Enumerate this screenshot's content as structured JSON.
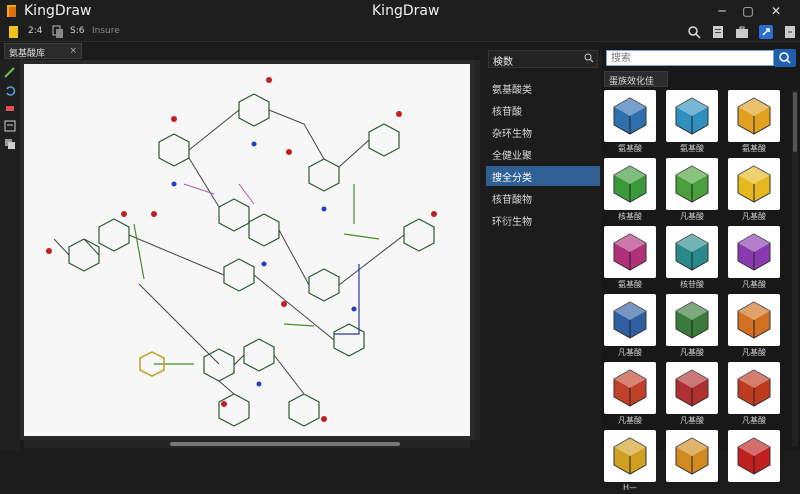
{
  "app": {
    "name": "KingDraw",
    "window_title": "KingDraw"
  },
  "toolbar": {
    "page_count": "2:4",
    "zoom": "S:6",
    "insert_label": "Insure"
  },
  "document": {
    "tab_label": "氨基酸库",
    "close": "×"
  },
  "middle_panel": {
    "header": "検数",
    "categories": [
      {
        "label": "氨基酸类",
        "selected": false
      },
      {
        "label": "核苷酸",
        "selected": false
      },
      {
        "label": "杂环生物",
        "selected": false
      },
      {
        "label": "全健业聚",
        "selected": false
      },
      {
        "label": "搜全分类",
        "selected": true
      },
      {
        "label": "核苷酸物",
        "selected": false
      },
      {
        "label": "环衍生物",
        "selected": false
      }
    ]
  },
  "right_panel": {
    "search_placeholder": "搜索",
    "library_title": "蛋族效化佳",
    "cards": [
      {
        "label": "氨基酸",
        "icon": "cube-multicolor-icon",
        "color": "#2f6fae"
      },
      {
        "label": "氨基酸",
        "icon": "cube-blue-icon",
        "color": "#2f8fbf"
      },
      {
        "label": "氨基酸",
        "icon": "cube-orange-icon",
        "color": "#e0a020"
      },
      {
        "label": "核基酸",
        "icon": "cube-green-icon",
        "color": "#3a9a3a"
      },
      {
        "label": "凡基酸",
        "icon": "cube-green-icon",
        "color": "#4aa03a"
      },
      {
        "label": "凡基酸",
        "icon": "cube-yellow-icon",
        "color": "#e6b820"
      },
      {
        "label": "氨基酸",
        "icon": "cube-magenta-icon",
        "color": "#b0307a"
      },
      {
        "label": "核苷酸",
        "icon": "cube-teal-icon",
        "color": "#2a8a8a"
      },
      {
        "label": "凡基酸",
        "icon": "cube-purple-icon",
        "color": "#8a3ab0"
      },
      {
        "label": "凡基酸",
        "icon": "blocks-blue-icon",
        "color": "#2f5fa0"
      },
      {
        "label": "凡基酸",
        "icon": "blocks-green-icon",
        "color": "#3a7a3a"
      },
      {
        "label": "凡基酸",
        "icon": "blocks-orange-icon",
        "color": "#d07020"
      },
      {
        "label": "凡基酸",
        "icon": "cube-red-icon",
        "color": "#c0402a"
      },
      {
        "label": "凡基酸",
        "icon": "cube-red-icon",
        "color": "#b03030"
      },
      {
        "label": "凡基酸",
        "icon": "cube-red-icon",
        "color": "#c03a20"
      },
      {
        "label": "H—",
        "icon": "molecule-icon",
        "color": "#d0a020"
      },
      {
        "label": "",
        "icon": "cube-orange-icon",
        "color": "#d08a20"
      },
      {
        "label": "",
        "icon": "molecule-icon",
        "color": "#c02020"
      }
    ]
  }
}
